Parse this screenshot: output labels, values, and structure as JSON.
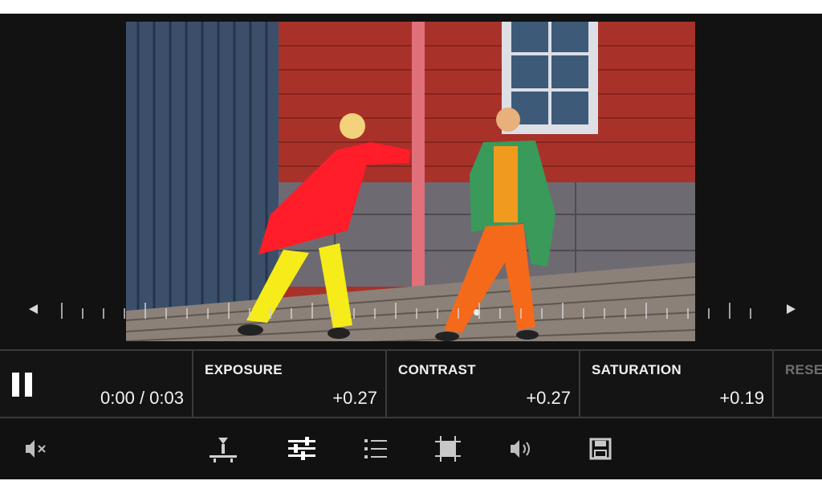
{
  "playback": {
    "state": "playing",
    "time": "0:00 / 0:03"
  },
  "adjustments": [
    {
      "label": "EXPOSURE",
      "value": "+0.27"
    },
    {
      "label": "CONTRAST",
      "value": "+0.27"
    },
    {
      "label": "SATURATION",
      "value": "+0.19"
    }
  ],
  "reset": {
    "label": "RESE"
  },
  "toolbar": {
    "icons": [
      "mute-icon",
      "trim-icon",
      "adjust-sliders-icon",
      "list-icon",
      "crop-icon",
      "volume-icon",
      "save-icon"
    ],
    "active": "adjust-sliders-icon"
  },
  "colors": {
    "background": "#111111",
    "divider": "#3b3b3b",
    "text": "#f2f2f2",
    "disabled_text": "#6f6f6f"
  }
}
